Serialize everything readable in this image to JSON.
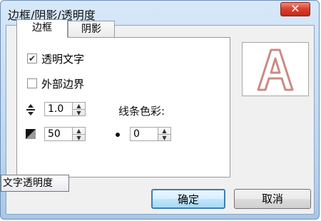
{
  "window": {
    "title": "边框/阴影/透明度"
  },
  "tabs": [
    {
      "label": "边框",
      "active": true
    },
    {
      "label": "阴影",
      "active": false
    }
  ],
  "options": {
    "transparent_text": {
      "label": "透明文字",
      "checked": true
    },
    "outer_border": {
      "label": "外部边界",
      "checked": false
    }
  },
  "line_spacing": {
    "value": "1.0",
    "icon": "line-spacing-icon"
  },
  "line_color": {
    "label": "线条色彩:",
    "color": "#7d2a1c"
  },
  "transparency": {
    "value": "50",
    "icon": "transparency-icon"
  },
  "blur": {
    "value": "0",
    "icon": "dot-icon"
  },
  "tooltip": {
    "text": "文字透明度"
  },
  "preview": {
    "glyph": "A",
    "outline_color": "#c98c84"
  },
  "buttons": {
    "ok": "确定",
    "cancel": "取消"
  }
}
